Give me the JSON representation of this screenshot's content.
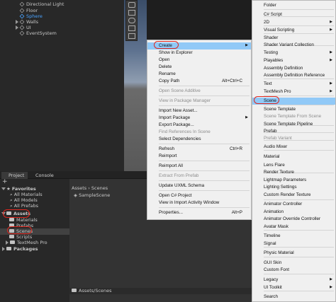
{
  "hierarchy": {
    "items": [
      "Directional Light",
      "Floor",
      "Sphere",
      "Walls",
      "UI",
      "EventSystem"
    ]
  },
  "project": {
    "tabs": [
      "Project",
      "Console"
    ],
    "add_label": "+",
    "tree": {
      "favorites": "Favorites",
      "fav_items": [
        "All Materials",
        "All Models",
        "All Prefabs"
      ],
      "assets": "Assets",
      "asset_items": [
        "Materials",
        "Prefabs",
        "Scenes",
        "Scripts",
        "TextMesh Pro"
      ],
      "packages": "Packages"
    },
    "breadcrumb": [
      "Assets",
      "Scenes"
    ],
    "file": "SampleScene",
    "footer_path": "Assets/Scenes"
  },
  "context_menu": {
    "create": "Create",
    "items": [
      {
        "label": "Show in Explorer"
      },
      {
        "label": "Open"
      },
      {
        "label": "Delete"
      },
      {
        "label": "Rename"
      },
      {
        "label": "Copy Path",
        "shortcut": "Alt+Ctrl+C"
      },
      {
        "label": "Open Scene Additive",
        "disabled": true
      },
      {
        "label": "View in Package Manager",
        "disabled": true
      },
      {
        "label": "Import New Asset..."
      },
      {
        "label": "Import Package"
      },
      {
        "label": "Export Package..."
      },
      {
        "label": "Find References In Scene",
        "disabled": true
      },
      {
        "label": "Select Dependencies"
      },
      {
        "label": "Refresh",
        "shortcut": "Ctrl+R"
      },
      {
        "label": "Reimport"
      },
      {
        "label": "Reimport All"
      },
      {
        "label": "Extract From Prefab",
        "disabled": true
      },
      {
        "label": "Update UXML Schema"
      },
      {
        "label": "Open C# Project"
      },
      {
        "label": "View in Import Activity Window"
      },
      {
        "label": "Properties...",
        "shortcut": "Alt+P"
      }
    ]
  },
  "create_menu": {
    "items": [
      "Folder",
      "C# Script",
      "2D",
      "Visual Scripting",
      "Shader",
      "Shader Variant Collection",
      "Testing",
      "Playables",
      "Assembly Definition",
      "Assembly Definition Reference",
      "Text",
      "TextMesh Pro",
      "Scene",
      "Scene Template",
      "Scene Template From Scene",
      "Scene Template Pipeline",
      "Prefab",
      "Prefab Variant",
      "Audio Mixer",
      "Material",
      "Lens Flare",
      "Render Texture",
      "Lightmap Parameters",
      "Lighting Settings",
      "Custom Render Texture",
      "Animator Controller",
      "Animation",
      "Animator Override Controller",
      "Avatar Mask",
      "Timeline",
      "Signal",
      "Physic Material",
      "GUI Skin",
      "Custom Font",
      "Legacy",
      "UI Toolkit",
      "Search"
    ]
  },
  "colors": {
    "highlight": "#91c9f7",
    "annotation": "#e0271e"
  }
}
